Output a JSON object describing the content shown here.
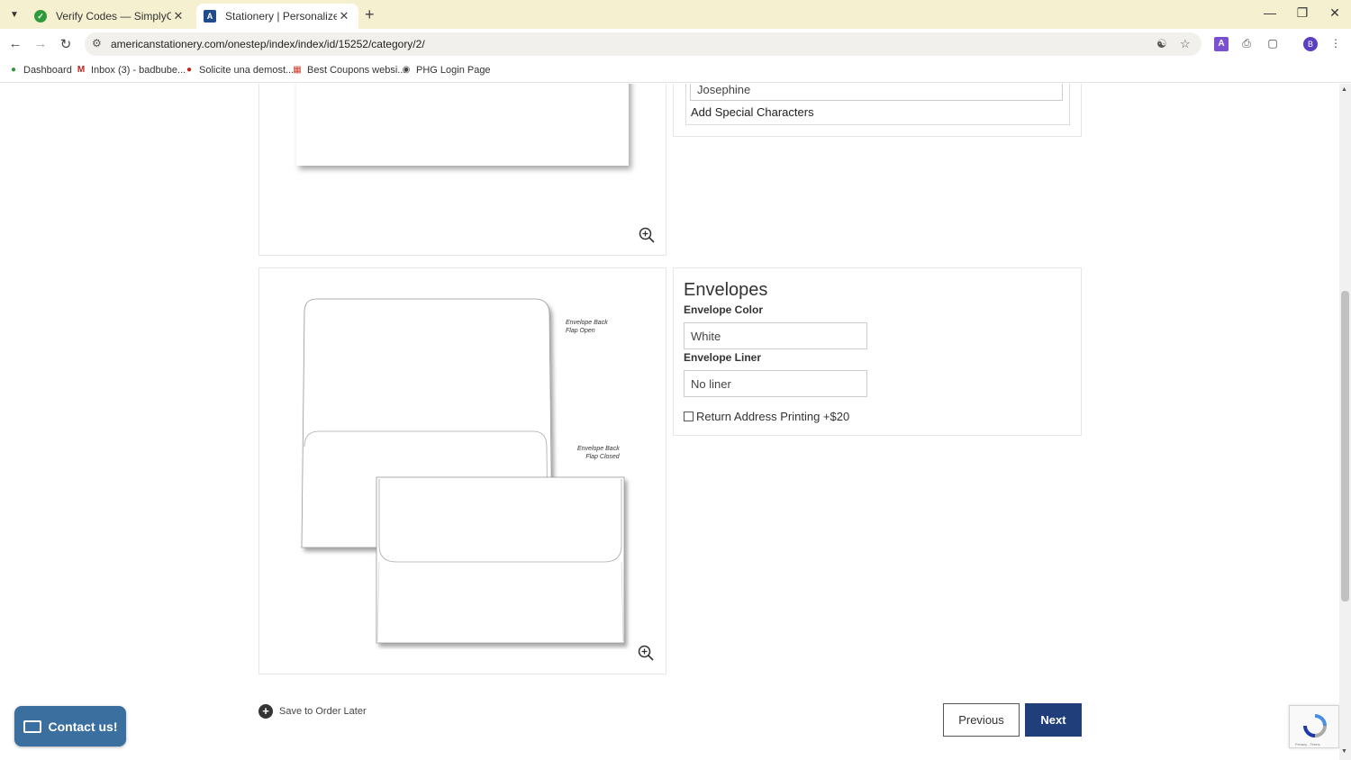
{
  "browser": {
    "tabs": [
      {
        "title": "Verify Codes — SimplyCodes",
        "active": false
      },
      {
        "title": "Stationery | Personalized Gifts |",
        "active": true
      }
    ],
    "url": "americanstationery.com/onestep/index/index/id/15252/category/2/",
    "bookmarks": [
      {
        "label": "Dashboard",
        "icon": "dashboard-icon"
      },
      {
        "label": "Inbox (3) - badbube...",
        "icon": "gmail-icon"
      },
      {
        "label": "Solicite una demost...",
        "icon": "person-icon"
      },
      {
        "label": "Best Coupons websi...",
        "icon": "grid-icon"
      },
      {
        "label": "PHG Login Page",
        "icon": "globe-icon"
      }
    ],
    "profile_initial": "B"
  },
  "stationery": {
    "name_value": "Josephine",
    "special_characters": "Add Special Characters"
  },
  "envelopes": {
    "title": "Envelopes",
    "color_label": "Envelope Color",
    "color_value": "White",
    "liner_label": "Envelope Liner",
    "liner_value": "No liner",
    "return_address_label": "Return Address Printing +$20",
    "return_address_checked": false,
    "note_open_line1": "Envelope Back",
    "note_open_line2": "Flap Open",
    "note_closed_line1": "Envelope Back",
    "note_closed_line2": "Flap Closed"
  },
  "footer": {
    "save_later": "Save to Order Later",
    "previous": "Previous",
    "next": "Next",
    "contact": "Contact us!",
    "recaptcha_text": "Privacy - Terms"
  },
  "colors": {
    "tabbar": "#f5f0cf",
    "next_button": "#1f3e7a",
    "contact_button": "#3b6fa0"
  }
}
